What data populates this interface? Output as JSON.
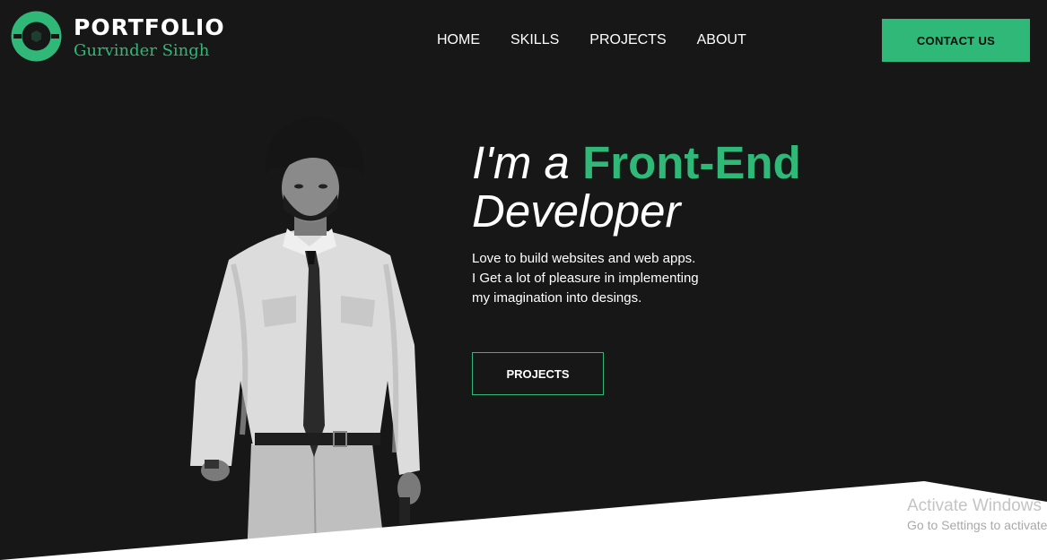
{
  "header": {
    "logo": {
      "title": "PORTFOLIO",
      "subtitle": "Gurvinder Singh",
      "icon": "logo-badge-icon"
    },
    "nav": [
      "HOME",
      "SKILLS",
      "PROJECTS",
      "ABOUT"
    ],
    "contact_label": "CONTACT US"
  },
  "hero": {
    "headline_pre": "I'm a",
    "headline_accent": "Front-End",
    "headline_line2": "Developer",
    "intro_lines": [
      "Love to build websites and web apps.",
      "I Get a lot of pleasure in implementing",
      "my imagination into desings."
    ],
    "projects_label": "PROJECTS",
    "portrait": "portrait-photo"
  },
  "watermark": {
    "title": "Activate Windows",
    "subtitle": "Go to Settings to activate Windows."
  },
  "colors": {
    "background": "#171717",
    "accent": "#2fb877",
    "text": "#ffffff"
  }
}
